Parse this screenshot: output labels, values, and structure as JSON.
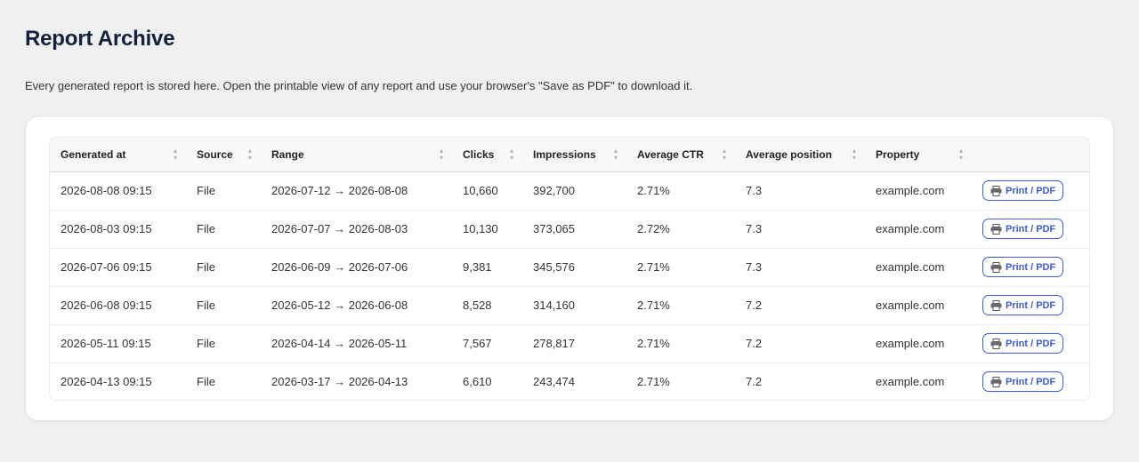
{
  "page": {
    "title": "Report Archive",
    "description": "Every generated report is stored here. Open the printable view of any report and use your browser's \"Save as PDF\" to download it."
  },
  "table": {
    "columns": [
      "Generated at",
      "Source",
      "Range",
      "Clicks",
      "Impressions",
      "Average CTR",
      "Average position",
      "Property",
      ""
    ],
    "action_label": "Print / PDF",
    "action_icon": "printer-icon",
    "accent_color": "#3b5bdb",
    "rows": [
      {
        "generated_at": "2026-08-08 09:15",
        "source": "File",
        "range": "2026-07-12 → 2026-08-08",
        "clicks": "10,660",
        "impressions": "392,700",
        "ctr": "2.71%",
        "position": "7.3",
        "property": "example.com"
      },
      {
        "generated_at": "2026-08-03 09:15",
        "source": "File",
        "range": "2026-07-07 → 2026-08-03",
        "clicks": "10,130",
        "impressions": "373,065",
        "ctr": "2.72%",
        "position": "7.3",
        "property": "example.com"
      },
      {
        "generated_at": "2026-07-06 09:15",
        "source": "File",
        "range": "2026-06-09 → 2026-07-06",
        "clicks": "9,381",
        "impressions": "345,576",
        "ctr": "2.71%",
        "position": "7.3",
        "property": "example.com"
      },
      {
        "generated_at": "2026-06-08 09:15",
        "source": "File",
        "range": "2026-05-12 → 2026-06-08",
        "clicks": "8,528",
        "impressions": "314,160",
        "ctr": "2.71%",
        "position": "7.2",
        "property": "example.com"
      },
      {
        "generated_at": "2026-05-11 09:15",
        "source": "File",
        "range": "2026-04-14 → 2026-05-11",
        "clicks": "7,567",
        "impressions": "278,817",
        "ctr": "2.71%",
        "position": "7.2",
        "property": "example.com"
      },
      {
        "generated_at": "2026-04-13 09:15",
        "source": "File",
        "range": "2026-03-17 → 2026-04-13",
        "clicks": "6,610",
        "impressions": "243,474",
        "ctr": "2.71%",
        "position": "7.2",
        "property": "example.com"
      }
    ]
  }
}
